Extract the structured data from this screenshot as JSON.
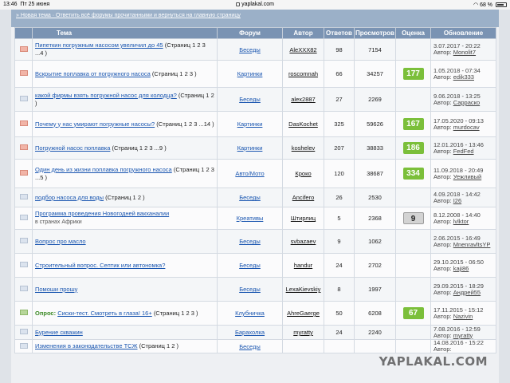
{
  "status_bar": {
    "time": "13:46",
    "date": "Пт 25 июня",
    "url": "yaplakal.com",
    "battery": "68 %"
  },
  "topbar": {
    "text": "» Новая тема · Ответить всё форумы прочитанными и вернуться на главную страницу"
  },
  "columns": {
    "topic": "Тема",
    "forum": "Форум",
    "author": "Автор",
    "replies": "Ответов",
    "views": "Просмотров",
    "rating": "Оценка",
    "updated": "Обновление"
  },
  "rows": [
    {
      "icon": "hot",
      "prefix": "",
      "title": "Пипеткин погружным насосом увеличил до 45",
      "pages": "(Страниц 1 2 3 ...4 )",
      "sub": "",
      "forum": "Беседы",
      "author": "AleXXX82",
      "replies": "98",
      "views": "7154",
      "rating": "",
      "rating_style": "",
      "upd_date": "3.07.2017 - 20:22",
      "upd_author_label": "Автор:",
      "upd_author": "Monolit7"
    },
    {
      "icon": "hot",
      "prefix": "",
      "title": "Вскрытие поплавка от погружного насоса",
      "pages": "(Страниц 1 2 3 )",
      "sub": "",
      "forum": "Картинки",
      "author": "roscomnah",
      "replies": "66",
      "views": "34257",
      "rating": "177",
      "rating_style": "green",
      "upd_date": "1.05.2018 - 07:34",
      "upd_author_label": "Автор:",
      "upd_author": "edik333"
    },
    {
      "icon": "normal",
      "prefix": "",
      "title": "какой фирмы взять погружной насос для колодца?",
      "pages": "(Страниц 1 2 )",
      "sub": "",
      "forum": "Беседы",
      "author": "alex2887",
      "replies": "27",
      "views": "2269",
      "rating": "",
      "rating_style": "",
      "upd_date": "9.06.2018 - 13:25",
      "upd_author_label": "Автор:",
      "upd_author": "Сарраско"
    },
    {
      "icon": "hot",
      "prefix": "",
      "title": "Почему у нас умирают погружные насосы?",
      "pages": "(Страниц 1 2 3 ...14 )",
      "sub": "",
      "forum": "Картинки",
      "author": "DasKochet",
      "replies": "325",
      "views": "59626",
      "rating": "167",
      "rating_style": "green",
      "upd_date": "17.05.2020 - 09:13",
      "upd_author_label": "Автор:",
      "upd_author": "murdocav"
    },
    {
      "icon": "hot",
      "prefix": "",
      "title": "Погружной насос поплавка",
      "pages": "(Страниц 1 2 3 ...9 )",
      "sub": "",
      "forum": "Картинки",
      "author": "koshelev",
      "replies": "207",
      "views": "38833",
      "rating": "186",
      "rating_style": "green",
      "upd_date": "12.01.2016 - 13:46",
      "upd_author_label": "Автор:",
      "upd_author": "FedFed"
    },
    {
      "icon": "hot",
      "prefix": "",
      "title": "Один день из жизни поплавка погружного насоса",
      "pages": "(Страниц 1 2 3 ...5 )",
      "sub": "",
      "forum": "Авто/Мото",
      "author": "Кроко",
      "replies": "120",
      "views": "38687",
      "rating": "334",
      "rating_style": "green",
      "upd_date": "11.09.2018 - 20:49",
      "upd_author_label": "Автор:",
      "upd_author": "Уежливый"
    },
    {
      "icon": "normal",
      "prefix": "",
      "title": "подбор насоса для воды",
      "pages": "(Страниц 1 2 )",
      "sub": "",
      "forum": "Беседы",
      "author": "Ancifero",
      "replies": "26",
      "views": "2530",
      "rating": "",
      "rating_style": "",
      "upd_date": "4.09.2018 - 14:42",
      "upd_author_label": "Автор:",
      "upd_author": "I26"
    },
    {
      "icon": "normal",
      "prefix": "",
      "title": "Программа проведения Новогодней вакханалии",
      "pages": "",
      "sub": "в странах Африки",
      "forum": "Креативы",
      "author": "Штирлиц",
      "replies": "5",
      "views": "2368",
      "rating": "9",
      "rating_style": "neutral",
      "upd_date": "8.12.2008 - 14:40",
      "upd_author_label": "Автор:",
      "upd_author": "lvlktor"
    },
    {
      "icon": "normal",
      "prefix": "",
      "title": "Вопрос про масло",
      "pages": "",
      "sub": "",
      "forum": "Беседы",
      "author": "svbazaev",
      "replies": "9",
      "views": "1062",
      "rating": "",
      "rating_style": "",
      "upd_date": "2.06.2015 - 16:49",
      "upd_author_label": "Автор:",
      "upd_author": "MnenravltsYP"
    },
    {
      "icon": "normal",
      "prefix": "",
      "title": "Строительный вопрос. Септик или автономка?",
      "pages": "",
      "sub": "",
      "forum": "Беседы",
      "author": "handur",
      "replies": "24",
      "views": "2702",
      "rating": "",
      "rating_style": "",
      "upd_date": "29.10.2015 - 06:50",
      "upd_author_label": "Автор:",
      "upd_author": "kaji86"
    },
    {
      "icon": "normal",
      "prefix": "",
      "title": "Помоши прошу",
      "pages": "",
      "sub": "",
      "forum": "Беседы",
      "author": "LexaKievskiy",
      "replies": "8",
      "views": "1997",
      "rating": "",
      "rating_style": "",
      "upd_date": "29.09.2015 - 18:29",
      "upd_author_label": "Автор:",
      "upd_author": "Андрей55"
    },
    {
      "icon": "green",
      "prefix": "Опрос:",
      "title": "Сиски-тест. Смотреть в глаза! 16+",
      "pages": "(Страниц 1 2 3 )",
      "sub": "",
      "forum": "Клубничка",
      "author": "AhreGaerge",
      "replies": "50",
      "views": "6208",
      "rating": "67",
      "rating_style": "green",
      "upd_date": "17.11.2015 - 15:12",
      "upd_author_label": "Автор:",
      "upd_author": "Nazivin"
    },
    {
      "icon": "normal",
      "prefix": "",
      "title": "Бурение скважин",
      "pages": "",
      "sub": "",
      "forum": "Барахолка",
      "author": "myratty",
      "replies": "24",
      "views": "2240",
      "rating": "",
      "rating_style": "",
      "upd_date": "7.08.2016 - 12:59",
      "upd_author_label": "Автор:",
      "upd_author": "myratty"
    },
    {
      "icon": "normal",
      "prefix": "",
      "title": "Изменения в законодательстве ТСЖ",
      "pages": "(Страниц 1 2 )",
      "sub": "",
      "forum": "Беседы",
      "author": "",
      "replies": "",
      "views": "",
      "rating": "",
      "rating_style": "",
      "upd_date": "14.08.2016 - 15:22",
      "upd_author_label": "Автор:",
      "upd_author": ""
    }
  ],
  "watermark": "YAPLAKAL.COM"
}
